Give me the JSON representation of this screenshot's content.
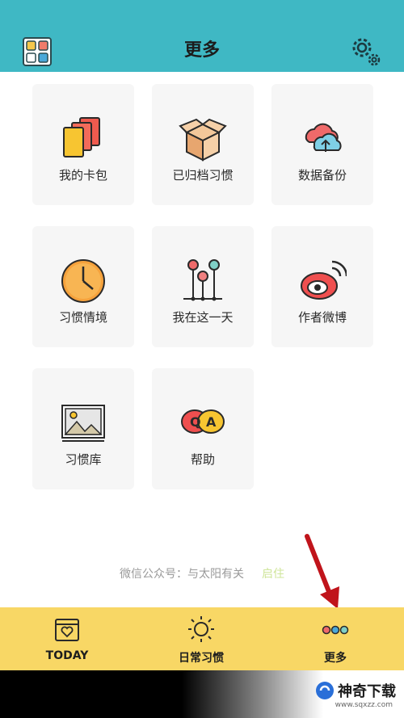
{
  "header": {
    "title": "更多"
  },
  "tiles": [
    {
      "label": "我的卡包"
    },
    {
      "label": "已归档习惯"
    },
    {
      "label": "数据备份"
    },
    {
      "label": "习惯情境"
    },
    {
      "label": "我在这一天"
    },
    {
      "label": "作者微博"
    },
    {
      "label": "习惯库"
    },
    {
      "label": "帮助"
    }
  ],
  "footer": {
    "text": "微信公众号：与太阳有关",
    "accent": "启住"
  },
  "tabbar": {
    "tabs": [
      {
        "label": "TODAY"
      },
      {
        "label": "日常习惯"
      },
      {
        "label": "更多"
      }
    ]
  },
  "watermark": {
    "brand": "神奇下载",
    "site": "www.sqxzz.com"
  },
  "colors": {
    "header": "#3fb8c4",
    "tabbar": "#f8d765",
    "tile_bg": "#f6f6f6"
  }
}
